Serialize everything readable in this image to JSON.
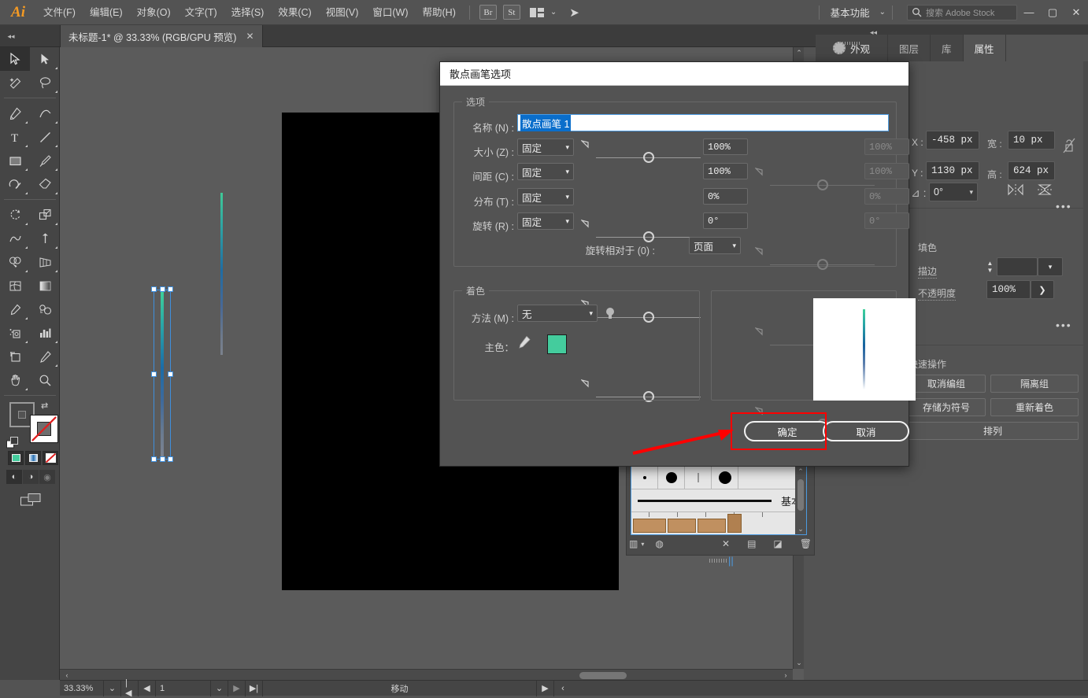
{
  "app": {
    "logo": "Ai"
  },
  "menubar": {
    "items": [
      "文件(F)",
      "编辑(E)",
      "对象(O)",
      "文字(T)",
      "选择(S)",
      "效果(C)",
      "视图(V)",
      "窗口(W)",
      "帮助(H)"
    ],
    "bridge_label": "Br",
    "stock_label": "St",
    "workspace": "基本功能",
    "search_placeholder": "搜索 Adobe Stock",
    "window_minimize": "—",
    "window_maximize": "▢",
    "window_close": "✕"
  },
  "document_tab": {
    "title": "未标题-1* @ 33.33% (RGB/GPU 预览)",
    "close": "✕"
  },
  "dialog": {
    "title": "散点画笔选项",
    "options_group_label": "选项",
    "name_label": "名称 (N) :",
    "name_value": "散点画笔 1",
    "rows": [
      {
        "label": "大小 (Z) :",
        "mode": "固定",
        "value": "100%",
        "value2": "100%"
      },
      {
        "label": "间距 (C) :",
        "mode": "固定",
        "value": "100%",
        "value2": "100%"
      },
      {
        "label": "分布 (T) :",
        "mode": "固定",
        "value": "0%",
        "value2": "0%"
      },
      {
        "label": "旋转 (R) :",
        "mode": "固定",
        "value": "0°",
        "value2": "0°"
      }
    ],
    "rotation_relative_label": "旋转相对于 (0) :",
    "rotation_relative_value": "页面",
    "colorization_group_label": "着色",
    "method_label": "方法 (M) :",
    "method_value": "无",
    "key_color_label": "主色：",
    "key_color_hex": "#44cc9d",
    "ok_label": "确定",
    "cancel_label": "取消"
  },
  "right_panel": {
    "appearance_tab": "外观",
    "tabs": [
      {
        "label": "图层",
        "active": false
      },
      {
        "label": "库",
        "active": false
      },
      {
        "label": "属性",
        "active": true
      }
    ],
    "transform": {
      "x_label": "X :",
      "x_value": "-458 px",
      "y_label": "Y :",
      "y_value": "1130 px",
      "w_label": "宽 :",
      "w_value": "10 px",
      "h_label": "高 :",
      "h_value": "624 px",
      "angle_label": "⊿ :",
      "angle_value": "0°"
    },
    "appearance": {
      "fill_label": "填色",
      "stroke_label": "描边",
      "stroke_value": "",
      "opacity_label": "不透明度",
      "opacity_value": "100%"
    },
    "quick_actions": {
      "title": "快速操作",
      "buttons": [
        "取消编组",
        "隔离组",
        "存储为符号",
        "重新着色",
        "排列"
      ]
    }
  },
  "brushes_panel": {
    "basic_label": "基本"
  },
  "statusbar": {
    "zoom": "33.33%",
    "artboard_number": "1",
    "tool_status": "移动"
  }
}
